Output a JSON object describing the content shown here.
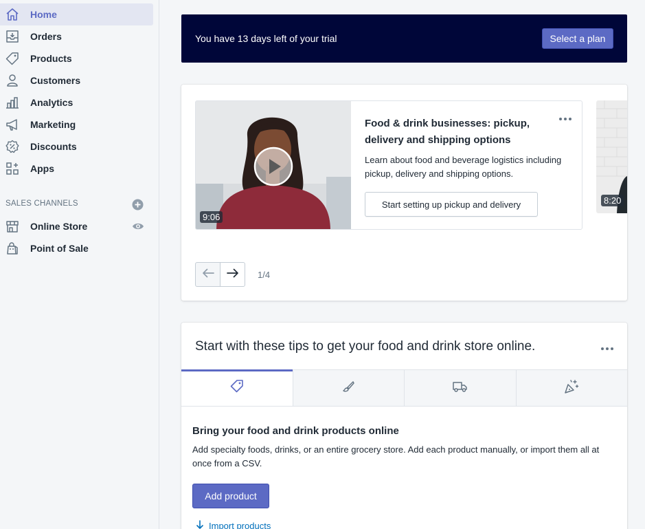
{
  "sidebar": {
    "items": [
      {
        "label": "Home",
        "icon": "home-icon",
        "active": true
      },
      {
        "label": "Orders",
        "icon": "orders-inbox-icon"
      },
      {
        "label": "Products",
        "icon": "tag-icon"
      },
      {
        "label": "Customers",
        "icon": "person-icon"
      },
      {
        "label": "Analytics",
        "icon": "bar-chart-icon"
      },
      {
        "label": "Marketing",
        "icon": "megaphone-icon"
      },
      {
        "label": "Discounts",
        "icon": "discount-badge-icon"
      },
      {
        "label": "Apps",
        "icon": "apps-grid-icon"
      }
    ],
    "sales_channels_heading": "SALES CHANNELS",
    "channels": [
      {
        "label": "Online Store",
        "icon": "storefront-icon"
      },
      {
        "label": "Point of Sale",
        "icon": "shopping-bag-icon"
      }
    ]
  },
  "banner": {
    "text": "You have 13 days left of your trial",
    "button": "Select a plan"
  },
  "video_carousel": {
    "current": {
      "title": "Food & drink businesses: pickup, delivery and shipping options",
      "description": "Learn about food and beverage logistics including pickup, delivery and shipping options.",
      "button": "Start setting up pickup and delivery",
      "duration": "9:06"
    },
    "next_duration": "8:20",
    "page_indicator": "1/4"
  },
  "tips": {
    "title": "Start with these tips to get your food and drink store online.",
    "tabs": [
      "tag-icon",
      "paintbrush-icon",
      "truck-icon",
      "magic-wand-icon"
    ],
    "heading": "Bring your food and drink products online",
    "body": "Add specialty foods, drinks, or an entire grocery store. Add each product manually, or import them all at once from a CSV.",
    "primary_button": "Add product",
    "secondary_link": "Import products"
  },
  "colors": {
    "accent": "#5c6ac4",
    "banner_bg": "#000639",
    "link": "#006fbb",
    "sidebar_bg": "#f4f6f8"
  }
}
